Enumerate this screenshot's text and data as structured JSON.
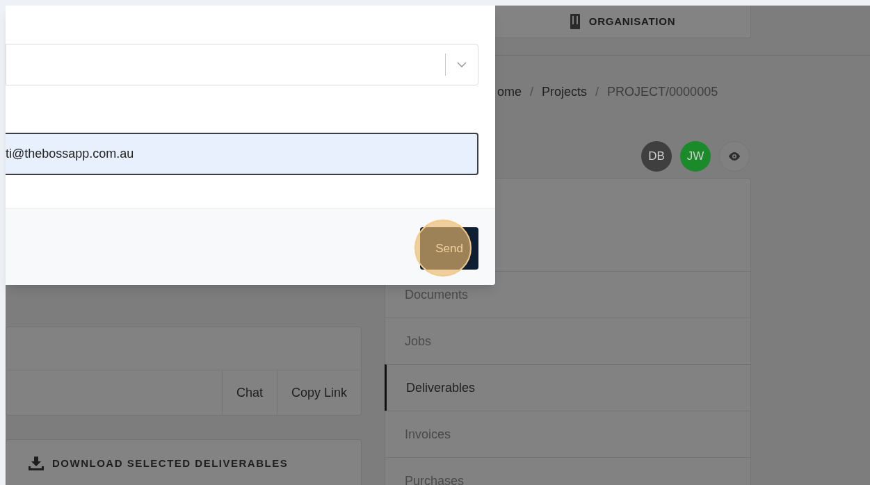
{
  "header": {
    "organisation_button": "ORGANISATION"
  },
  "breadcrumb": [
    {
      "label": "ome",
      "current": false
    },
    {
      "separator": "/",
      "label": "Projects",
      "current": false
    },
    {
      "separator": "/",
      "label": "PROJECT/0000005",
      "current": true
    }
  ],
  "avatars": [
    {
      "initials": "DB",
      "color": "#3f3f3f"
    },
    {
      "initials": "JW",
      "color": "#1a8a2a"
    }
  ],
  "nav": [
    {
      "label": "Documents",
      "selected": false
    },
    {
      "label": "Jobs",
      "selected": false
    },
    {
      "label": "Deliverables",
      "selected": true
    },
    {
      "label": "Invoices",
      "selected": false
    },
    {
      "label": "Purchases",
      "selected": false
    }
  ],
  "card_actions": [
    "Chat",
    "Copy Link"
  ],
  "download_button": "DOWNLOAD SELECTED DELIVERABLES",
  "modal": {
    "email": "ti@thebossapp.com.au",
    "send_button": "Send",
    "send_highlighted": true
  }
}
